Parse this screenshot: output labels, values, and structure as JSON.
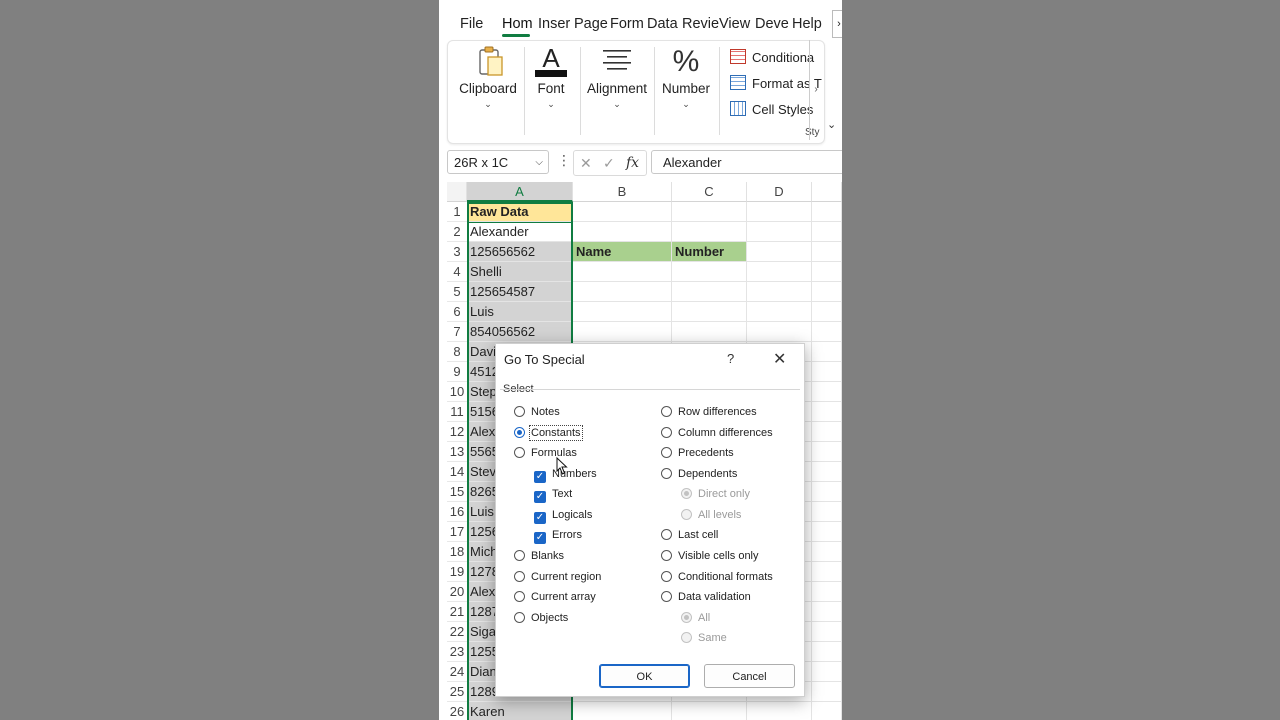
{
  "ribbon": {
    "tabs": [
      "File",
      "Hom",
      "Inser",
      "Page",
      "Form",
      "Data",
      "Revie",
      "View",
      "Deve",
      "Help"
    ],
    "active_tab": "Hom",
    "more": "›",
    "groups": [
      {
        "label": "Clipboard",
        "icon": "clipboard-icon"
      },
      {
        "label": "Font",
        "icon": "font-color-icon"
      },
      {
        "label": "Alignment",
        "icon": "align-icon"
      },
      {
        "label": "Number",
        "icon": "percent-icon"
      }
    ],
    "styles_items": [
      "Conditiona",
      "Format as T",
      "Cell Styles"
    ],
    "styles_caption": "Sty",
    "scroll_arrow": "›",
    "collapse": "⌄",
    "chevron": "⌄"
  },
  "formula_bar": {
    "namebox": "26R x 1C",
    "namebox_chev": "⌵",
    "dots": "⋮",
    "cancel": "✕",
    "confirm": "✓",
    "fx": "fx",
    "value": "Alexander"
  },
  "grid": {
    "columns": [
      "A",
      "B",
      "C",
      "D"
    ],
    "rows": [
      "1",
      "2",
      "3",
      "4",
      "5",
      "6",
      "7",
      "8",
      "9",
      "10",
      "11",
      "12",
      "13",
      "14",
      "15",
      "16",
      "17",
      "18",
      "19",
      "20",
      "21",
      "22",
      "23",
      "24",
      "25",
      "26"
    ],
    "colA": [
      "Raw Data",
      "Alexander",
      "125656562",
      "Shelli",
      "125654587",
      "Luis",
      "854056562",
      "Davi",
      "4512",
      "Step",
      "5156",
      "Alex",
      "5565",
      "Stev",
      "8265",
      "Luis",
      "1256",
      "Mich",
      "1278",
      "Alex",
      "1287",
      "Siga",
      "1255",
      "Dian",
      "1289",
      "Karen"
    ],
    "b3": "Name",
    "c3": "Number"
  },
  "dialog": {
    "title": "Go To Special",
    "help": "?",
    "close": "✕",
    "section": "Select",
    "left_options": [
      {
        "label": "Notes",
        "checked": false
      },
      {
        "label": "Constants",
        "checked": true
      },
      {
        "label": "Formulas",
        "checked": false
      },
      {
        "label": "Blanks",
        "checked": false
      },
      {
        "label": "Current region",
        "checked": false
      },
      {
        "label": "Current array",
        "checked": false
      },
      {
        "label": "Objects",
        "checked": false
      }
    ],
    "formula_subs": [
      "Numbers",
      "Text",
      "Logicals",
      "Errors"
    ],
    "right_options": [
      {
        "label": "Row differences",
        "checked": false
      },
      {
        "label": "Column differences",
        "checked": false
      },
      {
        "label": "Precedents",
        "checked": false
      },
      {
        "label": "Dependents",
        "checked": false
      },
      {
        "label": "Last cell",
        "checked": false
      },
      {
        "label": "Visible cells only",
        "checked": false
      },
      {
        "label": "Conditional formats",
        "checked": false
      },
      {
        "label": "Data validation",
        "checked": false
      }
    ],
    "dependents_subs": [
      "Direct only",
      "All levels"
    ],
    "validation_subs": [
      "All",
      "Same"
    ],
    "ok": "OK",
    "cancel": "Cancel",
    "check_glyph": "✓"
  }
}
